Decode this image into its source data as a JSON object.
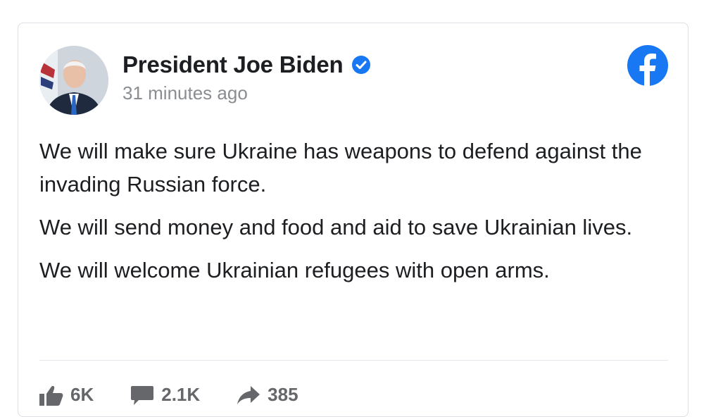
{
  "post": {
    "author": "President Joe Biden",
    "timestamp": "31 minutes ago",
    "paragraphs": [
      "We will make sure Ukraine has weapons to defend against the invading Russian force.",
      "We will send money and food and aid to save Ukrainian lives.",
      "We will welcome Ukrainian refugees with open arms."
    ],
    "stats": {
      "likes": "6K",
      "comments": "2.1K",
      "shares": "385"
    }
  },
  "icons": {
    "verified": "verified-badge-icon",
    "platform": "facebook-logo-icon",
    "like": "thumbs-up-icon",
    "comment": "comment-bubble-icon",
    "share": "share-arrow-icon"
  },
  "colors": {
    "facebook_blue": "#1877f2",
    "text_primary": "#1c1e21",
    "text_secondary": "#8a8d91"
  }
}
